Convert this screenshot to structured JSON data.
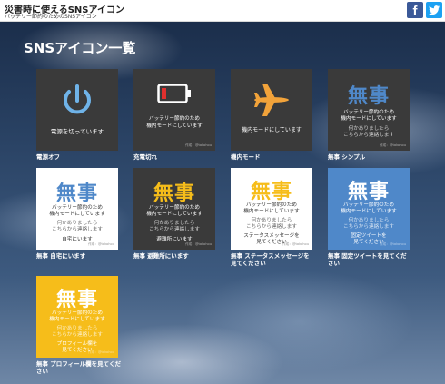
{
  "header": {
    "title": "災害時に使えるSNSアイコン",
    "subtitle": "バッテリー節約のためのSNSアイコン",
    "facebook_letter": "f",
    "colors": {
      "facebook": "#3b5998",
      "twitter": "#1da1f2"
    }
  },
  "page": {
    "title": "SNSアイコン一覧"
  },
  "watermark": "作成：@takohou",
  "colors": {
    "dark_tile": "#3a3a3a",
    "yellow_tile": "#f6bd1a",
    "blue_tile": "#4f88c9",
    "blue_text": "#4f88c9"
  },
  "tiles": [
    {
      "caption": "電源オフ",
      "text": "電源を切っています"
    },
    {
      "caption": "充電切れ",
      "line1": "バッテリー節約のため",
      "line2": "機内モードにしています"
    },
    {
      "caption": "機内モード",
      "text": "機内モードにしています"
    },
    {
      "caption": "無事 シンプル",
      "big": "無事",
      "line1": "バッテリー節約のため",
      "line2": "機内モードにしています",
      "line3": "何かありましたら",
      "line4": "こちらから連絡します"
    },
    {
      "caption": "無事 自宅にいます",
      "big": "無事",
      "line1": "バッテリー節約のため",
      "line2": "機内モードにしています",
      "line3": "何かありましたら",
      "line4": "こちらから連絡します",
      "line5": "自宅にいます"
    },
    {
      "caption": "無事 避難所にいます",
      "big": "無事",
      "line1": "バッテリー節約のため",
      "line2": "機内モードにしています",
      "line3": "何かありましたら",
      "line4": "こちらから連絡します",
      "line5": "避難所にいます"
    },
    {
      "caption1": "無事 ステータスメッセージを",
      "caption2": "見てください",
      "big": "無事",
      "line1": "バッテリー節約のため",
      "line2": "機内モードにしています",
      "line3": "何かありましたら",
      "line4": "こちらから連絡します",
      "line5": "ステータスメッセージを",
      "line6": "見てください"
    },
    {
      "caption1": "無事 固定ツイートを見てくだ",
      "caption2": "さい",
      "big": "無事",
      "line1": "バッテリー節約のため",
      "line2": "機内モードにしています",
      "line3": "何かありましたら",
      "line4": "こちらから連絡します",
      "line5": "固定ツイートを",
      "line6": "見てください"
    },
    {
      "caption1": "無事 プロフィール欄を見てくだ",
      "caption2": "さい",
      "big": "無事",
      "line1": "バッテリー節約のため",
      "line2": "機内モードにしています",
      "line3": "何かありましたら",
      "line4": "こちらから連絡します",
      "line5": "プロフィール欄を",
      "line6": "見てください"
    }
  ]
}
